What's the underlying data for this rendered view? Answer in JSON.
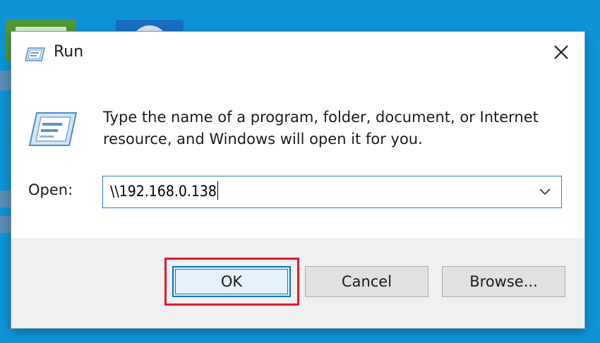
{
  "dialog": {
    "title": "Run",
    "description": "Type the name of a program, folder, document, or Internet resource, and Windows will open it for you.",
    "open_label": "Open:",
    "open_value": "\\\\192.168.0.138",
    "buttons": {
      "ok": "OK",
      "cancel": "Cancel",
      "browse": "Browse..."
    }
  },
  "icons": {
    "title": "run-icon",
    "content": "run-icon",
    "close": "close-icon",
    "dropdown": "chevron-down-icon"
  },
  "colors": {
    "desktop": "#0f93d8",
    "focus_border": "#0078d7",
    "highlight": "#e0192b",
    "footer": "#f0f0f0"
  }
}
